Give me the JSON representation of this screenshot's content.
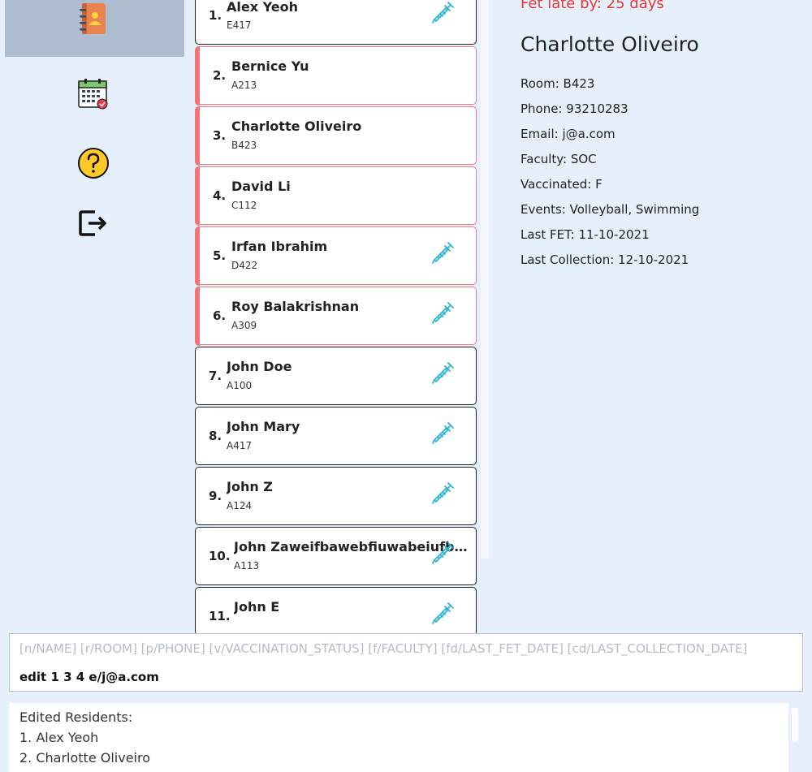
{
  "app": {
    "sidebar": {
      "items": [
        {
          "icon": "address-book-icon",
          "selected": true
        },
        {
          "icon": "calendar-icon",
          "selected": false
        },
        {
          "icon": "help-icon",
          "selected": false
        },
        {
          "icon": "exit-icon",
          "selected": false
        }
      ]
    },
    "colors": {
      "background": "#e6f0fc",
      "late_accent": "#f27474",
      "vaccine_icon": "#2cb5d6",
      "alert_text": "#e53935"
    },
    "residents": [
      {
        "index": "1.",
        "name": "Alex Yeoh",
        "room": "E417",
        "late": false,
        "vaccinated": true
      },
      {
        "index": "2.",
        "name": "Bernice Yu",
        "room": "A213",
        "late": true,
        "vaccinated": false
      },
      {
        "index": "3.",
        "name": "Charlotte Oliveiro",
        "room": "B423",
        "late": true,
        "vaccinated": false
      },
      {
        "index": "4.",
        "name": "David Li",
        "room": "C112",
        "late": true,
        "vaccinated": false
      },
      {
        "index": "5.",
        "name": "Irfan Ibrahim",
        "room": "D422",
        "late": true,
        "vaccinated": true
      },
      {
        "index": "6.",
        "name": "Roy Balakrishnan",
        "room": "A309",
        "late": true,
        "vaccinated": true
      },
      {
        "index": "7.",
        "name": "John Doe",
        "room": "A100",
        "late": false,
        "vaccinated": true
      },
      {
        "index": "8.",
        "name": "John Mary",
        "room": "A417",
        "late": false,
        "vaccinated": true
      },
      {
        "index": "9.",
        "name": "John Z",
        "room": "A124",
        "late": false,
        "vaccinated": true
      },
      {
        "index": "10.",
        "name": "John Zaweifbawebfiuwabeiufbiauwebfiuabwefiubawe",
        "room": "A113",
        "late": false,
        "vaccinated": true
      },
      {
        "index": "11.",
        "name": "John E",
        "room": "",
        "late": false,
        "vaccinated": true
      }
    ],
    "details": {
      "fet_late": "Fet late by: 25 days",
      "name": "Charlotte Oliveiro",
      "fields": [
        "Room: B423",
        "Phone: 93210283",
        "Email: j@a.com",
        "Faculty: SOC",
        "Vaccinated: F",
        "Events: Volleyball, Swimming",
        "Last FET: 11-10-2021",
        "Last Collection: 12-10-2021"
      ]
    },
    "command": {
      "placeholder": "[n/NAME] [r/ROOM] [p/PHONE] [v/VACCINATION_STATUS] [f/FACULTY] [fd/LAST_FET_DATE] [cd/LAST_COLLECTION_DATE]",
      "value": "edit 1 3 4 e/j@a.com"
    },
    "result": {
      "lines": [
        "Edited Residents:",
        "1.      Alex Yeoh",
        "2.      Charlotte Oliveiro"
      ]
    }
  }
}
